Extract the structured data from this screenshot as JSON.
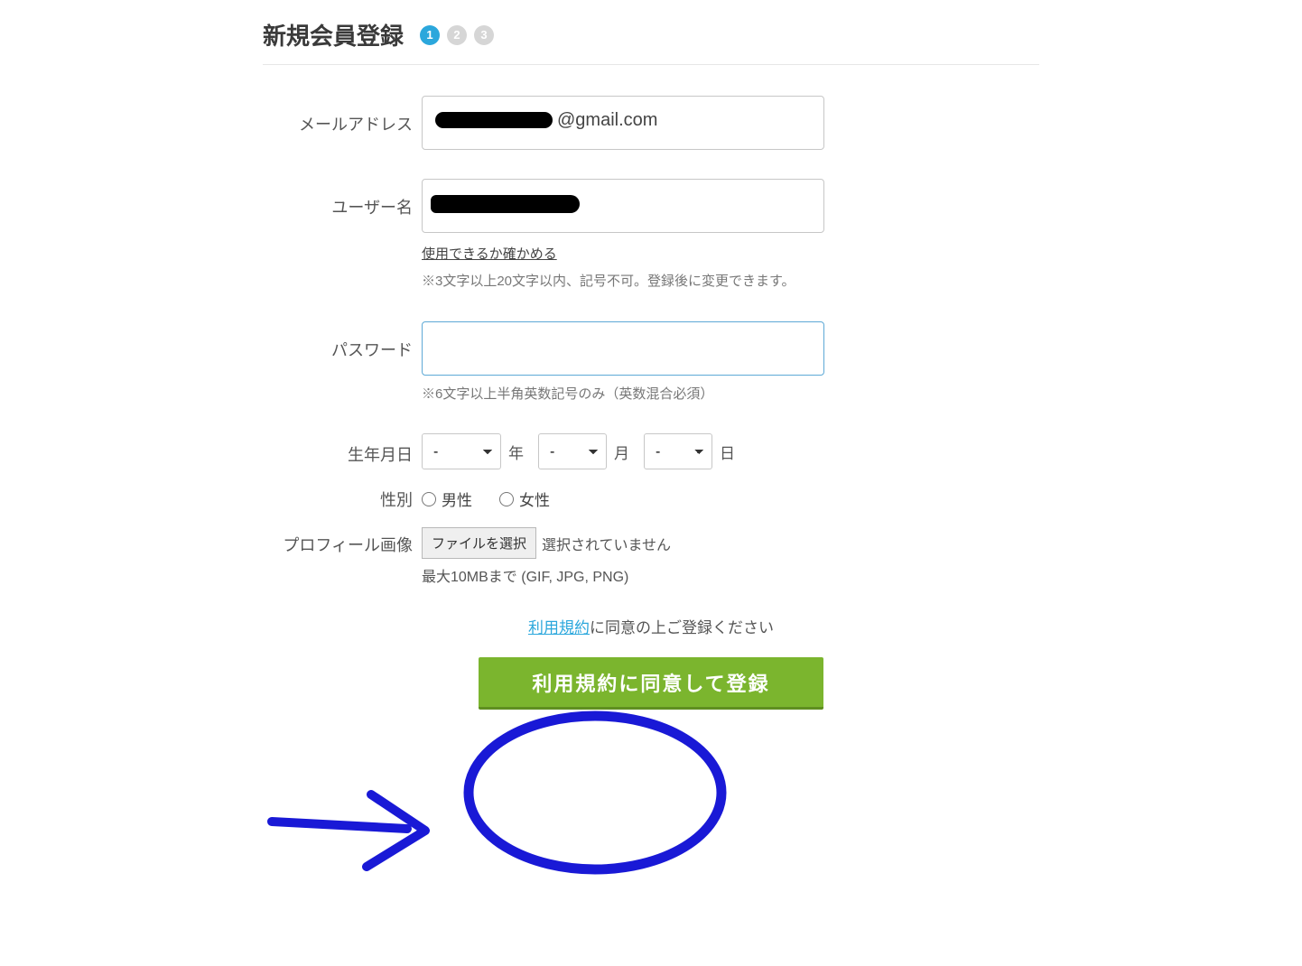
{
  "header": {
    "title": "新規会員登録",
    "steps": [
      "1",
      "2",
      "3"
    ],
    "active_step": 0
  },
  "form": {
    "email": {
      "label": "メールアドレス",
      "visible_fragment": "@gmail.com"
    },
    "username": {
      "label": "ユーザー名",
      "check_link": "使用できるか確かめる",
      "hint": "※3文字以上20文字以内、記号不可。登録後に変更できます。"
    },
    "password": {
      "label": "パスワード",
      "hint": "※6文字以上半角英数記号のみ（英数混合必須）",
      "value": ""
    },
    "birthdate": {
      "label": "生年月日",
      "year_selected": "-",
      "month_selected": "-",
      "day_selected": "-",
      "unit_year": "年",
      "unit_month": "月",
      "unit_day": "日"
    },
    "gender": {
      "label": "性別",
      "option_male": "男性",
      "option_female": "女性"
    },
    "profile_image": {
      "label": "プロフィール画像",
      "button": "ファイルを選択",
      "status": "選択されていません",
      "hint": "最大10MBまで (GIF, JPG, PNG)"
    }
  },
  "terms": {
    "link_text": "利用規約",
    "suffix": "に同意の上ご登録ください"
  },
  "submit": {
    "label": "利用規約に同意して登録"
  }
}
